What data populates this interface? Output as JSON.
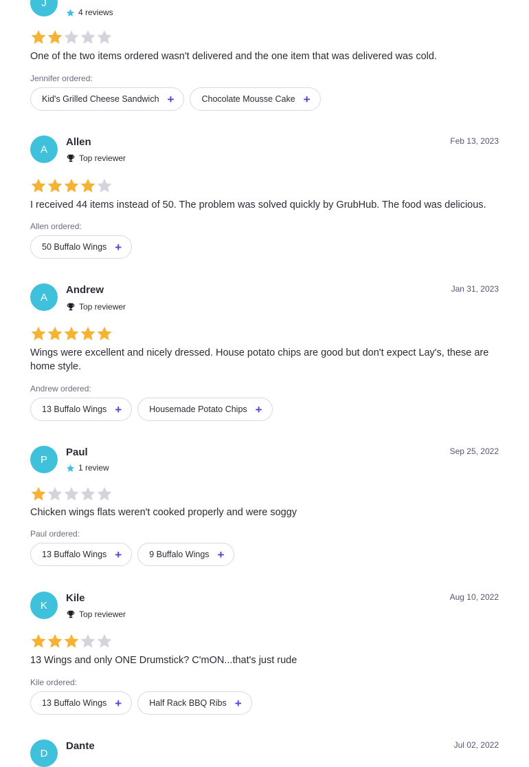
{
  "colors": {
    "avatar": "#3fc1dc",
    "star_filled": "#f6b232",
    "star_empty": "#d4d4dc",
    "accent_plus": "#5b3fd6",
    "review_count_star": "#3fc1dc"
  },
  "icons": {
    "trophy": "trophy-icon",
    "star": "star-icon",
    "plus": "plus-icon"
  },
  "reviews": [
    {
      "initial": "J",
      "name": "",
      "date": "",
      "badge_type": "reviews",
      "badge_text": "4 reviews",
      "rating": 2,
      "text": "One of the two items ordered wasn't delivered and the one item that was delivered was cold.",
      "ordered_label": "Jennifer ordered:",
      "items": [
        "Kid's Grilled Cheese Sandwich",
        "Chocolate Mousse Cake"
      ]
    },
    {
      "initial": "A",
      "name": "Allen",
      "date": "Feb 13, 2023",
      "badge_type": "top",
      "badge_text": "Top reviewer",
      "rating": 4,
      "text": "I received 44 items instead of 50. The problem was solved quickly by GrubHub. The food was delicious.",
      "ordered_label": "Allen ordered:",
      "items": [
        "50 Buffalo Wings"
      ]
    },
    {
      "initial": "A",
      "name": "Andrew",
      "date": "Jan 31, 2023",
      "badge_type": "top",
      "badge_text": "Top reviewer",
      "rating": 5,
      "text": "Wings were excellent and nicely dressed. House potato chips are good but don't expect Lay's, these are home style.",
      "ordered_label": "Andrew ordered:",
      "items": [
        "13 Buffalo Wings",
        "Housemade Potato Chips"
      ]
    },
    {
      "initial": "P",
      "name": "Paul",
      "date": "Sep 25, 2022",
      "badge_type": "reviews",
      "badge_text": "1 review",
      "rating": 1,
      "text": "Chicken wings flats weren't cooked properly and were soggy",
      "ordered_label": "Paul ordered:",
      "items": [
        "13 Buffalo Wings",
        "9 Buffalo Wings"
      ]
    },
    {
      "initial": "K",
      "name": "Kile",
      "date": "Aug 10, 2022",
      "badge_type": "top",
      "badge_text": "Top reviewer",
      "rating": 3,
      "text": "13 Wings and only ONE Drumstick? C'mON...that's just rude",
      "ordered_label": "Kile ordered:",
      "items": [
        "13 Buffalo Wings",
        "Half Rack BBQ Ribs"
      ]
    },
    {
      "initial": "D",
      "name": "Dante",
      "date": "Jul 02, 2022",
      "badge_type": "",
      "badge_text": "",
      "rating": 0,
      "text": "",
      "ordered_label": "",
      "items": []
    }
  ]
}
